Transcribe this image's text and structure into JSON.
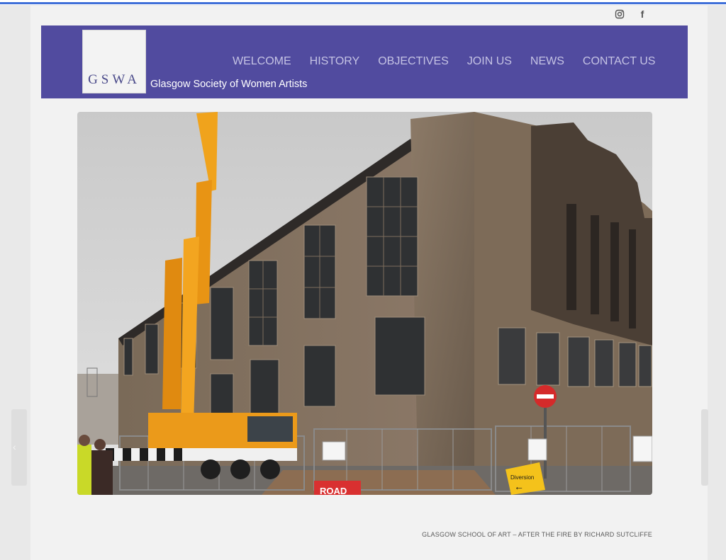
{
  "brand": {
    "logo_text": "GSWA",
    "tagline": "Glasgow Society of Women Artists"
  },
  "social": [
    {
      "icon": "instagram-icon"
    },
    {
      "icon": "facebook-icon",
      "glyph": "f"
    }
  ],
  "nav": {
    "items": [
      {
        "label": "WELCOME"
      },
      {
        "label": "HISTORY"
      },
      {
        "label": "OBJECTIVES"
      },
      {
        "label": "JOIN US"
      },
      {
        "label": "NEWS"
      },
      {
        "label": "CONTACT US"
      }
    ]
  },
  "slider": {
    "prev_glyph": "‹",
    "caption": "GLASGOW SCHOOL OF ART – AFTER THE FIRE BY RICHARD SUTCLIFFE",
    "signs": {
      "road": "ROAD",
      "diversion": "Diversion"
    }
  },
  "colors": {
    "header_bg": "#514b9f",
    "nav_text": "#c5c3e4",
    "browser_accent": "#3f6fd8"
  }
}
